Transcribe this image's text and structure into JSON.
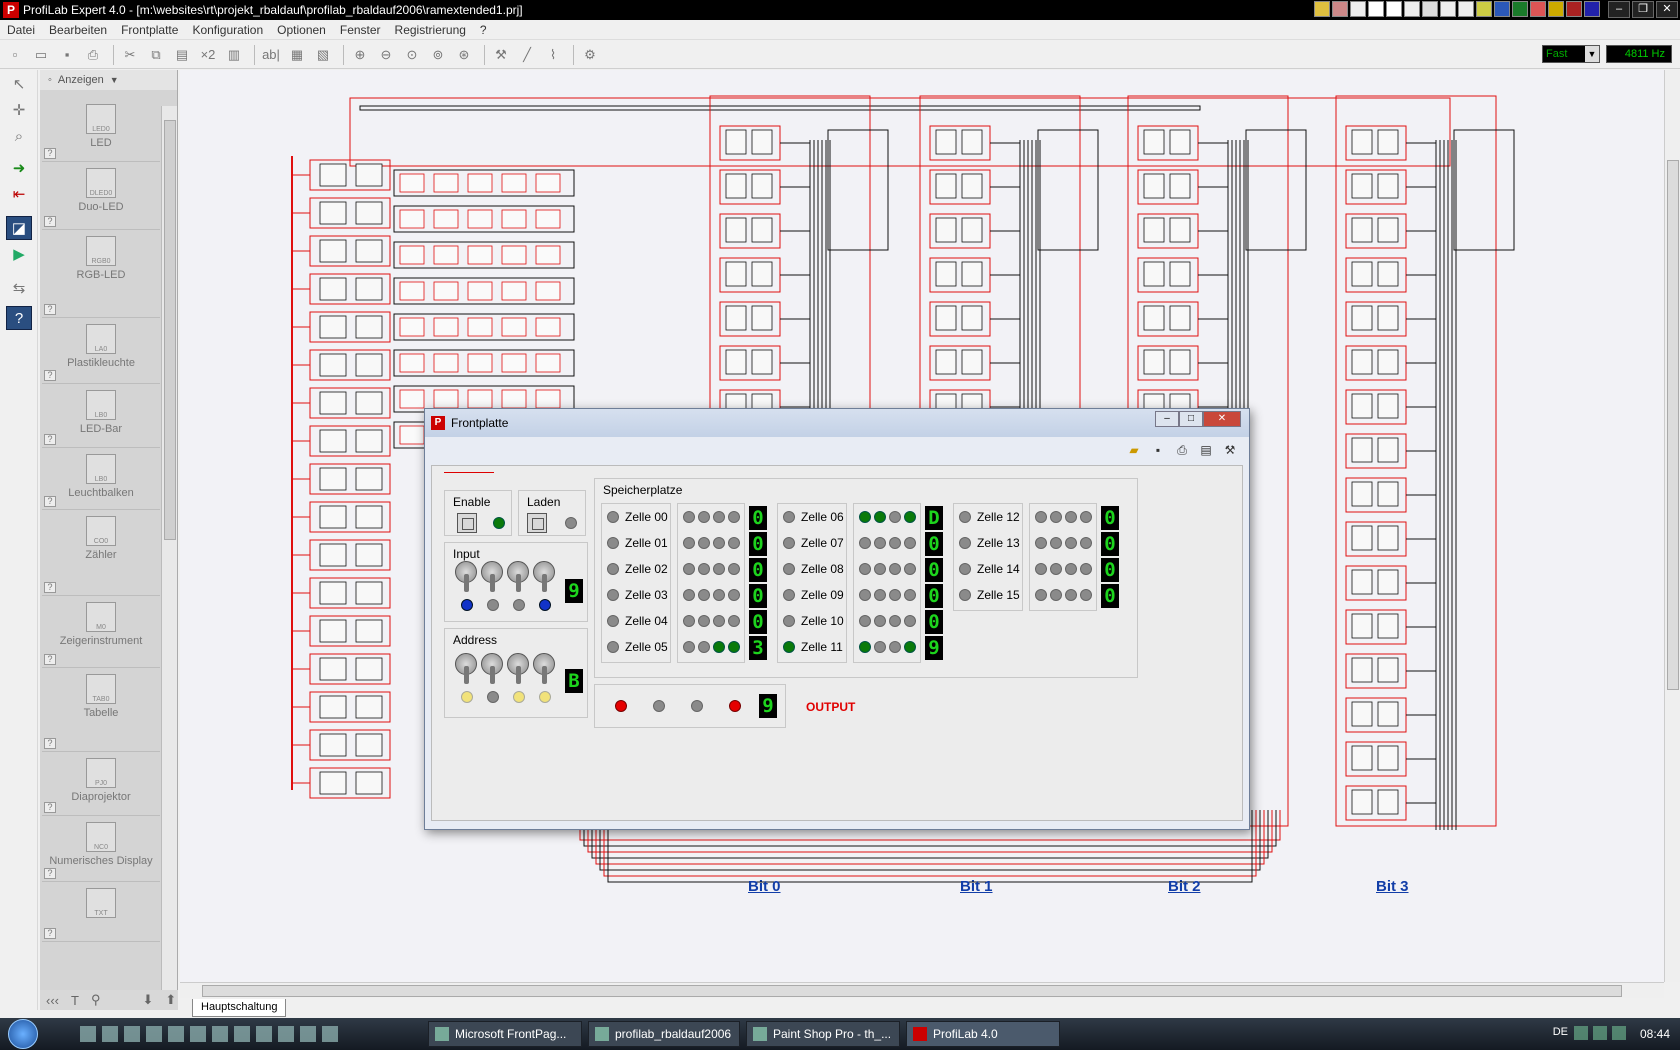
{
  "window": {
    "title": "ProfiLab Expert 4.0 - [m:\\websites\\rt\\projekt_rbaldauf\\profilab_rbaldauf2006\\ramextended1.prj]",
    "app_icon": "P"
  },
  "menu": [
    "Datei",
    "Bearbeiten",
    "Frontplatte",
    "Konfiguration",
    "Optionen",
    "Fenster",
    "Registrierung",
    "?"
  ],
  "toolbar": {
    "text_tool_label": "ab|",
    "multiply_label": "×2",
    "speed_value": "Fast",
    "frequency": "4811 Hz"
  },
  "library": {
    "view_label": "Anzeigen",
    "help_glyph": "?",
    "items": [
      {
        "label": "LED",
        "icon": "led-icon",
        "symbol": "LED0"
      },
      {
        "label": "Duo-LED",
        "icon": "duo-led-icon",
        "symbol": "DLED0"
      },
      {
        "label": "RGB-LED",
        "icon": "rgb-led-icon",
        "symbol": "RGB0"
      },
      {
        "label": "Plastikleuchte",
        "icon": "plastikleuchte-icon",
        "symbol": "LA0"
      },
      {
        "label": "LED-Bar",
        "icon": "led-bar-icon",
        "symbol": "LB0"
      },
      {
        "label": "Leuchtbalken",
        "icon": "leuchtbalken-icon",
        "symbol": "LB0"
      },
      {
        "label": "Zähler",
        "icon": "counter-icon",
        "symbol": "CO0"
      },
      {
        "label": "Zeigerinstrument",
        "icon": "meter-icon",
        "symbol": "M0"
      },
      {
        "label": "Tabelle",
        "icon": "table-icon",
        "symbol": "TAB0"
      },
      {
        "label": "Diaprojektor",
        "icon": "projector-icon",
        "symbol": "PJ0"
      },
      {
        "label": "Numerisches Display",
        "icon": "numeric-display-icon",
        "symbol": "NC0"
      },
      {
        "label": "",
        "icon": "text-display-icon",
        "symbol": "TXT"
      }
    ]
  },
  "canvas": {
    "bits": [
      "Bit 0",
      "Bit 1",
      "Bit 2",
      "Bit 3"
    ],
    "sheet_tab": "Hauptschaltung",
    "colors": {
      "wire_red": "#e01010",
      "wire_black": "#111111",
      "background": "#f2f2f6"
    }
  },
  "frontplatte": {
    "title": "Frontplatte",
    "enable": {
      "label": "Enable",
      "led": "green"
    },
    "laden": {
      "label": "Laden",
      "led": "gray"
    },
    "input": {
      "label": "Input",
      "leds": [
        "blue",
        "gray",
        "gray",
        "blue"
      ],
      "display": "9"
    },
    "address": {
      "label": "Address",
      "leds": [
        "yellow",
        "gray",
        "yellow",
        "yellow"
      ],
      "display": "B"
    },
    "speicher": {
      "label": "Speicherplatze",
      "cells": [
        {
          "name": "Zelle 00",
          "led": "gray",
          "bits": [
            "gray",
            "gray",
            "gray",
            "gray"
          ],
          "value": "0"
        },
        {
          "name": "Zelle 01",
          "led": "gray",
          "bits": [
            "gray",
            "gray",
            "gray",
            "gray"
          ],
          "value": "0"
        },
        {
          "name": "Zelle 02",
          "led": "gray",
          "bits": [
            "gray",
            "gray",
            "gray",
            "gray"
          ],
          "value": "0"
        },
        {
          "name": "Zelle 03",
          "led": "gray",
          "bits": [
            "gray",
            "gray",
            "gray",
            "gray"
          ],
          "value": "0"
        },
        {
          "name": "Zelle 04",
          "led": "gray",
          "bits": [
            "gray",
            "gray",
            "gray",
            "gray"
          ],
          "value": "0"
        },
        {
          "name": "Zelle 05",
          "led": "gray",
          "bits": [
            "gray",
            "gray",
            "green",
            "green"
          ],
          "value": "3"
        },
        {
          "name": "Zelle 06",
          "led": "gray",
          "bits": [
            "green",
            "green",
            "gray",
            "green"
          ],
          "value": "D"
        },
        {
          "name": "Zelle 07",
          "led": "gray",
          "bits": [
            "gray",
            "gray",
            "gray",
            "gray"
          ],
          "value": "0"
        },
        {
          "name": "Zelle 08",
          "led": "gray",
          "bits": [
            "gray",
            "gray",
            "gray",
            "gray"
          ],
          "value": "0"
        },
        {
          "name": "Zelle 09",
          "led": "gray",
          "bits": [
            "gray",
            "gray",
            "gray",
            "gray"
          ],
          "value": "0"
        },
        {
          "name": "Zelle 10",
          "led": "gray",
          "bits": [
            "gray",
            "gray",
            "gray",
            "gray"
          ],
          "value": "0"
        },
        {
          "name": "Zelle 11",
          "led": "green",
          "bits": [
            "green",
            "gray",
            "gray",
            "green"
          ],
          "value": "9"
        },
        {
          "name": "Zelle 12",
          "led": "gray",
          "bits": [
            "gray",
            "gray",
            "gray",
            "gray"
          ],
          "value": "0"
        },
        {
          "name": "Zelle 13",
          "led": "gray",
          "bits": [
            "gray",
            "gray",
            "gray",
            "gray"
          ],
          "value": "0"
        },
        {
          "name": "Zelle 14",
          "led": "gray",
          "bits": [
            "gray",
            "gray",
            "gray",
            "gray"
          ],
          "value": "0"
        },
        {
          "name": "Zelle 15",
          "led": "gray",
          "bits": [
            "gray",
            "gray",
            "gray",
            "gray"
          ],
          "value": "0"
        }
      ]
    },
    "output": {
      "label": "OUTPUT",
      "leds": [
        "red",
        "gray",
        "gray",
        "red"
      ],
      "display": "9"
    }
  },
  "taskbar": {
    "tasks": [
      {
        "label": "Microsoft FrontPag...",
        "icon": "frontpage-icon",
        "active": false
      },
      {
        "label": "profilab_rbaldauf2006",
        "icon": "folder-icon",
        "active": false
      },
      {
        "label": "Paint Shop Pro - th_...",
        "icon": "paintshop-icon",
        "active": false
      },
      {
        "label": "ProfiLab 4.0",
        "icon": "profilab-icon",
        "active": true
      }
    ],
    "language": "DE",
    "clock": "08:44"
  }
}
